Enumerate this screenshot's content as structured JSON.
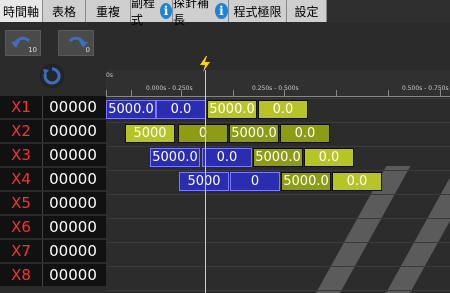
{
  "tabs": [
    {
      "label": "時間軸",
      "w": 43
    },
    {
      "label": "表格",
      "w": 43
    },
    {
      "label": "重複",
      "w": 45
    },
    {
      "label": "副程式",
      "w": 42,
      "info": true
    },
    {
      "label": "探針補長",
      "w": 56,
      "info": true
    },
    {
      "label": "程式極限",
      "w": 58
    },
    {
      "label": "設定",
      "w": 40
    }
  ],
  "toolbar": {
    "undo_count": "10",
    "redo_count": "0"
  },
  "ruler": {
    "start": "0s",
    "labels": [
      "0.000s - 0.250s",
      "0.250s - 0.500s",
      "0.500s - 0.750s"
    ]
  },
  "rows": [
    {
      "label": "X1",
      "value": "00000"
    },
    {
      "label": "X2",
      "value": "00000"
    },
    {
      "label": "X3",
      "value": "00000"
    },
    {
      "label": "X4",
      "value": "00000"
    },
    {
      "label": "X5",
      "value": "00000"
    },
    {
      "label": "X6",
      "value": "00000"
    },
    {
      "label": "X7",
      "value": "00000"
    },
    {
      "label": "X8",
      "value": "00000"
    }
  ],
  "segments": [
    {
      "row": 0,
      "text": "5000.0",
      "color": "blue"
    },
    {
      "row": 0,
      "text": "0.0",
      "color": "blue"
    },
    {
      "row": 0,
      "text": "5000.0",
      "color": "lime"
    },
    {
      "row": 0,
      "text": "0.0",
      "color": "lime"
    },
    {
      "row": 1,
      "text": "5000",
      "color": "lime"
    },
    {
      "row": 1,
      "text": "0",
      "color": "olive"
    },
    {
      "row": 1,
      "text": "5000.0",
      "color": "olive"
    },
    {
      "row": 1,
      "text": "0.0",
      "color": "olive"
    },
    {
      "row": 2,
      "text": "5000.0",
      "color": "blue"
    },
    {
      "row": 2,
      "text": "0.0",
      "color": "blue"
    },
    {
      "row": 2,
      "text": "5000.0",
      "color": "olive"
    },
    {
      "row": 2,
      "text": "0.0",
      "color": "lime"
    },
    {
      "row": 3,
      "text": "5000",
      "color": "blue"
    },
    {
      "row": 3,
      "text": "0",
      "color": "blue"
    },
    {
      "row": 3,
      "text": "5000.0",
      "color": "olive"
    },
    {
      "row": 3,
      "text": "0.0",
      "color": "lime"
    }
  ],
  "colors": {
    "blue": "#2b2db0",
    "olive": "#8e9c14",
    "lime": "#b7c426",
    "label": "#ff3030",
    "cursor": "#e8e030",
    "info": "#1b84d8"
  }
}
